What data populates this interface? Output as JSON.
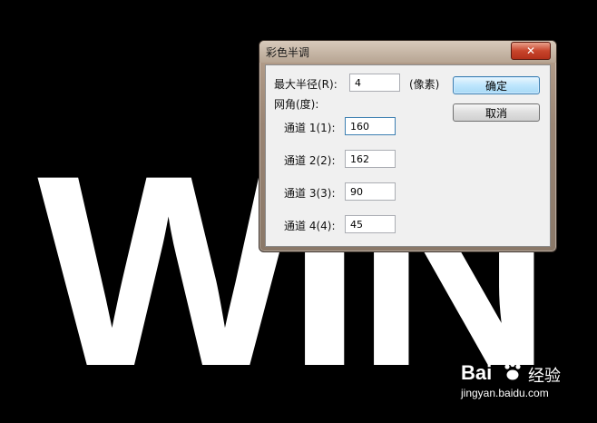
{
  "background": {
    "letters": [
      "W",
      "I",
      "N"
    ]
  },
  "dialog": {
    "title": "彩色半调",
    "close_label": "✕",
    "max_radius": {
      "label": "最大半径(R):",
      "value": "4",
      "unit": "(像素)"
    },
    "screen_angles_label": "网角(度):",
    "channels": [
      {
        "label": "通道 1(1):",
        "value": "160"
      },
      {
        "label": "通道 2(2):",
        "value": "162"
      },
      {
        "label": "通道 3(3):",
        "value": "90"
      },
      {
        "label": "通道 4(4):",
        "value": "45"
      }
    ],
    "ok_label": "确定",
    "cancel_label": "取消"
  },
  "watermark": {
    "brand": "Bai",
    "suffix": "经验",
    "url": "jingyan.baidu.com"
  },
  "colors": {
    "dialog_bg": "#f0f0f0",
    "close_red": "#c8452c",
    "default_button": "#bee6fd"
  }
}
